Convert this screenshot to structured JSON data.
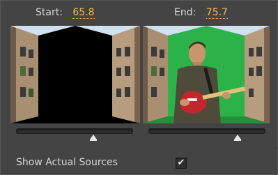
{
  "start": {
    "label": "Start:",
    "value": "65.8",
    "slider_fraction": 0.66
  },
  "end": {
    "label": "End:",
    "value": "75.7",
    "slider_fraction": 0.76
  },
  "show_actual_sources": {
    "label": "Show Actual Sources",
    "checked": true,
    "check_glyph": "✔"
  },
  "colors": {
    "accent": "#f2b94a",
    "panel": "#444444",
    "text": "#d6d6d6",
    "green_screen": "#2bb34a"
  }
}
